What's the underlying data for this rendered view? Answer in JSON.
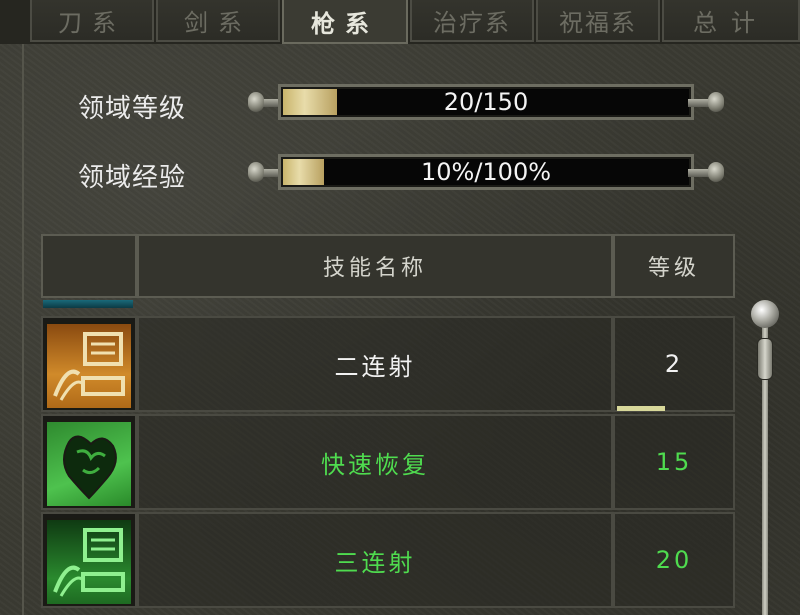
{
  "tabs": [
    {
      "label": "刀系",
      "active": false
    },
    {
      "label": "剑系",
      "active": false
    },
    {
      "label": "枪系",
      "active": true
    },
    {
      "label": "治疗系",
      "active": false
    },
    {
      "label": "祝福系",
      "active": false
    },
    {
      "label": "总计",
      "active": false
    }
  ],
  "domain": {
    "level_label": "领域等级",
    "level_value": "20/150",
    "level_progress": 0.133,
    "exp_label": "领域经验",
    "exp_value": "10%/100%",
    "exp_progress": 0.1
  },
  "table": {
    "headers": [
      "",
      "技能名称",
      "等级"
    ],
    "rows": [
      {
        "name": "二连射",
        "level": "2",
        "icon": "scroll-bow-icon",
        "text_color": "#f2f2f2",
        "icon_style": "orange"
      },
      {
        "name": "快速恢复",
        "level": "15",
        "icon": "heart-icon",
        "text_color": "#4fdc4f",
        "icon_style": "green"
      },
      {
        "name": "三连射",
        "level": "20",
        "icon": "scroll-bow-icon",
        "text_color": "#4fdc4f",
        "icon_style": "dgreen"
      }
    ]
  },
  "colors": {
    "white_text": "#f2f2f2",
    "green_text": "#4fdc4f",
    "bar_fill": "#d8c98a"
  }
}
